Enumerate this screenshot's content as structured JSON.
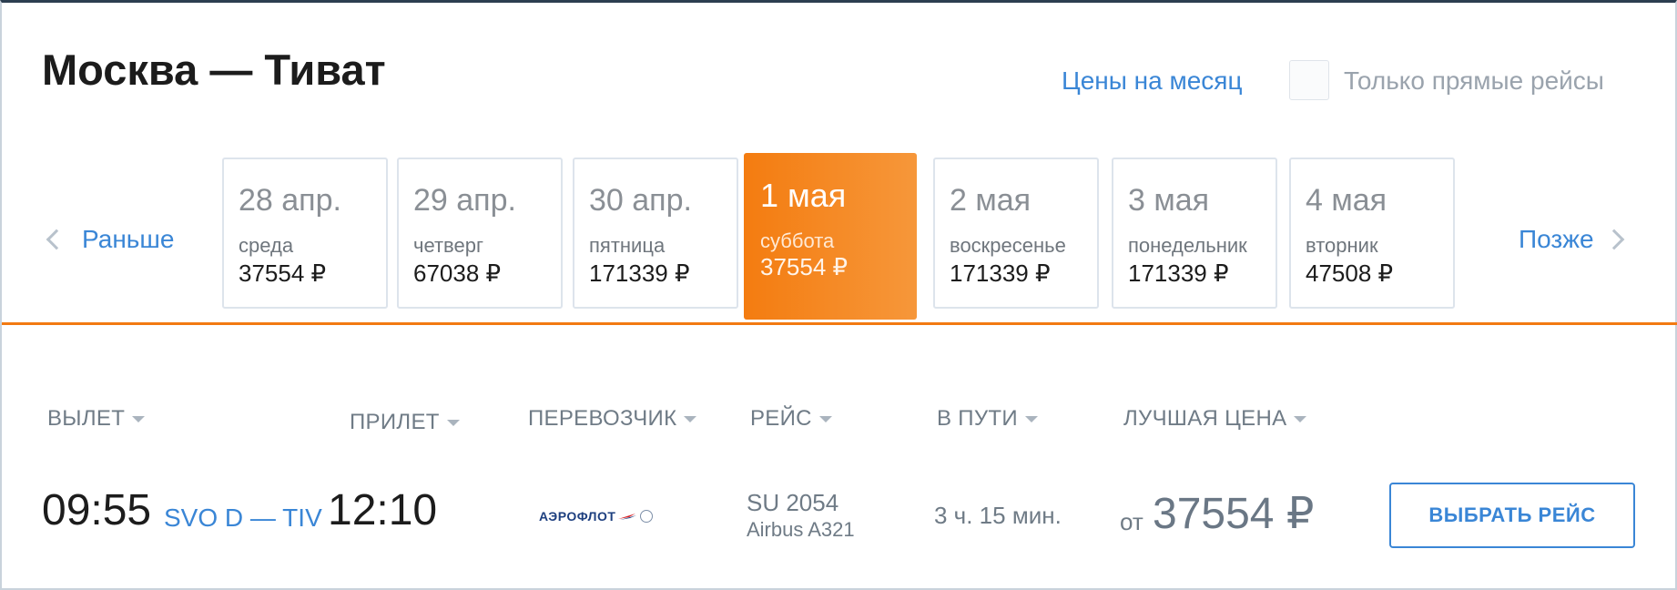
{
  "header": {
    "title": "Москва — Тиват",
    "month_prices_link": "Цены на месяц",
    "direct_only_label": "Только прямые рейсы",
    "direct_only_checked": false
  },
  "date_nav": {
    "prev_label": "Раньше",
    "next_label": "Позже"
  },
  "dates": [
    {
      "date": "28 апр.",
      "weekday": "среда",
      "price": "37554 ₽",
      "selected": false
    },
    {
      "date": "29 апр.",
      "weekday": "четверг",
      "price": "67038 ₽",
      "selected": false
    },
    {
      "date": "30 апр.",
      "weekday": "пятница",
      "price": "171339 ₽",
      "selected": false
    },
    {
      "date": "1 мая",
      "weekday": "суббота",
      "price": "37554 ₽",
      "selected": true
    },
    {
      "date": "2 мая",
      "weekday": "воскресенье",
      "price": "171339 ₽",
      "selected": false
    },
    {
      "date": "3 мая",
      "weekday": "понедельник",
      "price": "171339 ₽",
      "selected": false
    },
    {
      "date": "4 мая",
      "weekday": "вторник",
      "price": "47508 ₽",
      "selected": false
    }
  ],
  "columns": {
    "departure": "ВЫЛЕТ",
    "arrival": "ПРИЛЕТ",
    "carrier": "ПЕРЕВОЗЧИК",
    "flight": "РЕЙС",
    "duration": "В ПУТИ",
    "best_price": "ЛУЧШАЯ ЦЕНА"
  },
  "flight": {
    "departure_time": "09:55",
    "route": "SVO D — TIV",
    "arrival_time": "12:10",
    "carrier_logo_text": "АЭРОФЛОТ",
    "flight_number": "SU 2054",
    "aircraft": "Airbus A321",
    "duration": "3 ч. 15 мин.",
    "price_prefix": "от",
    "price": "37554 ₽",
    "select_label": "ВЫБРАТЬ РЕЙС"
  },
  "colors": {
    "accent_orange": "#f47c10",
    "link_blue": "#3a86d6",
    "muted_text": "#6f7b86"
  }
}
